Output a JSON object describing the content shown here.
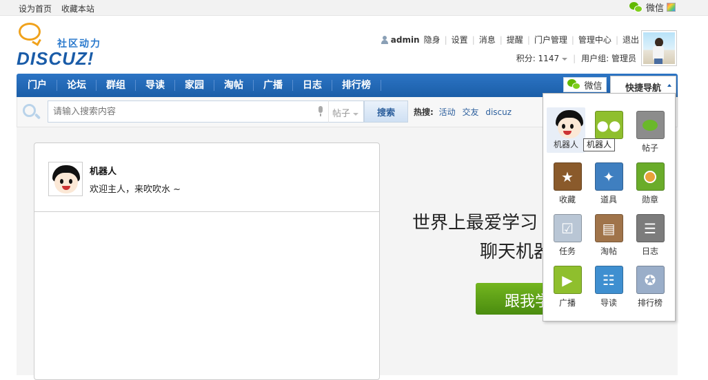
{
  "topbar": {
    "set_home": "设为首页",
    "bookmark": "收藏本站",
    "wechat": "微信"
  },
  "logo": {
    "slogan": "社区动力",
    "brand": "DISCUZ!"
  },
  "user": {
    "name": "admin",
    "invisible": "隐身",
    "links": [
      "设置",
      "消息",
      "提醒",
      "门户管理",
      "管理中心",
      "退出"
    ],
    "points_label": "积分: 1147",
    "group_label": "用户组: 管理员"
  },
  "nav": {
    "items": [
      "门户",
      "论坛",
      "群组",
      "导读",
      "家园",
      "淘帖",
      "广播",
      "日志",
      "排行榜"
    ],
    "wechat": "微信",
    "quick_nav": "快捷导航"
  },
  "search": {
    "placeholder": "请输入搜索内容",
    "type": "帖子",
    "button": "搜索",
    "hot_label": "热搜:",
    "hot": [
      "活动",
      "交友",
      "discuz"
    ]
  },
  "chat": {
    "bot_name": "机器人",
    "greeting": "欢迎主人，来吹吹水 ~"
  },
  "hero": {
    "title": "世界上最爱学习",
    "subtitle": "聊天机器",
    "button": "跟我学"
  },
  "quick_panel": {
    "items": [
      {
        "label": "机器人",
        "icon": "robot-icon",
        "color": "#ffffff"
      },
      {
        "label": "",
        "icon": "group-icon",
        "color": "#8fbf2d"
      },
      {
        "label": "帖子",
        "icon": "post-icon",
        "color": "#8c8c8c"
      },
      {
        "label": "收藏",
        "icon": "star-icon",
        "color": "#8a5a2b"
      },
      {
        "label": "道具",
        "icon": "magic-wand-icon",
        "color": "#3f7fc0"
      },
      {
        "label": "勋章",
        "icon": "medal-icon",
        "color": "#6aac2a"
      },
      {
        "label": "任务",
        "icon": "task-icon",
        "color": "#b9c6d5"
      },
      {
        "label": "淘帖",
        "icon": "inbox-icon",
        "color": "#a0744a"
      },
      {
        "label": "日志",
        "icon": "journal-icon",
        "color": "#7c7c7c"
      },
      {
        "label": "广播",
        "icon": "megaphone-icon",
        "color": "#8fbf2d"
      },
      {
        "label": "导读",
        "icon": "reader-icon",
        "color": "#3f8fd0"
      },
      {
        "label": "排行榜",
        "icon": "ranking-icon",
        "color": "#9aaec9"
      }
    ],
    "tooltip": "机器人"
  }
}
